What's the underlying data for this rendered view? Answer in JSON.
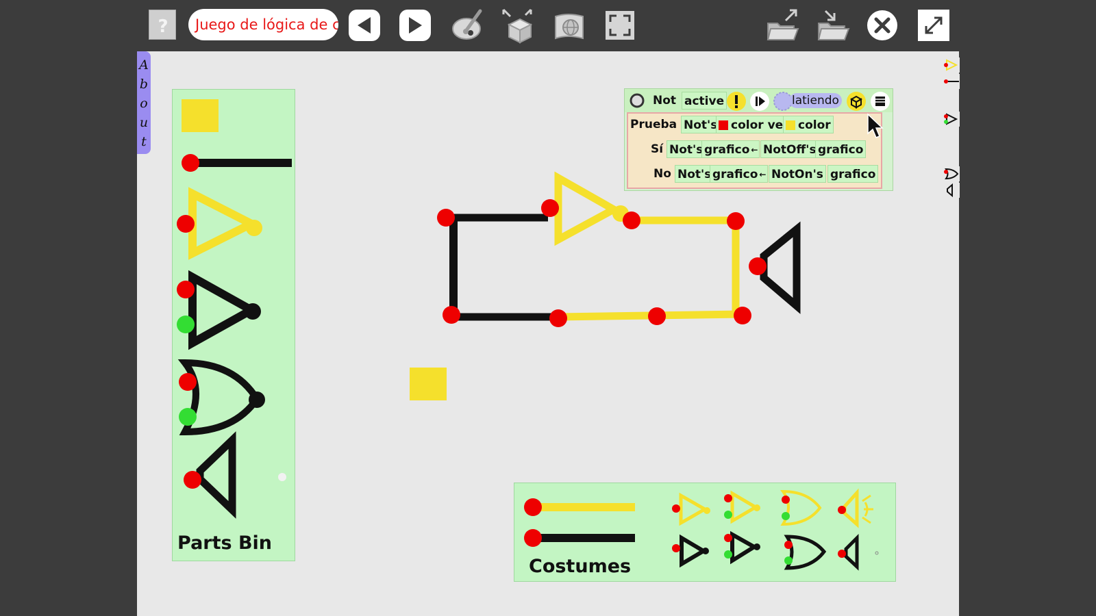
{
  "toolbar": {
    "help_icon": "help-icon",
    "project_name": "Juego de lógica de c",
    "prev_icon": "triangle-left-icon",
    "next_icon": "triangle-right-icon",
    "paint_icon": "paint-palette-icon",
    "supplies_icon": "supplies-box-icon",
    "language_icon": "globe-icon",
    "fullscreen_icon": "fullscreen-icon",
    "load_icon": "folder-open-icon",
    "save_icon": "folder-save-icon",
    "close_icon": "close-icon",
    "expand_icon": "expand-icon"
  },
  "about_flap": {
    "letters": [
      "A",
      "b",
      "o",
      "u",
      "t"
    ]
  },
  "parts_bin": {
    "title": "Parts Bin"
  },
  "costumes": {
    "title": "Costumes"
  },
  "script": {
    "object_name": "Not",
    "status": "active",
    "tick_label": "latiendo",
    "test_label": "Prueba",
    "test_object": "Not's",
    "test_color_a": "color ve",
    "test_color_b": "color",
    "yes_label": "Sí",
    "yes_target": "Not's",
    "yes_slot": "grafico",
    "yes_source": "NotOff's",
    "yes_source_slot": "grafico",
    "no_label": "No",
    "no_target": "Not's",
    "no_slot": "grafico",
    "no_source": "NotOn's",
    "no_source_slot": "grafico"
  },
  "colors": {
    "background": "#3c3c3c",
    "world": "#e8e8e8",
    "bin": "#c3f5c3",
    "wire_on": "#f5e02c",
    "wire_off": "#111111",
    "pin_red": "#ee0000",
    "pin_green": "#33dd33",
    "flap": "#9a8cf0"
  }
}
